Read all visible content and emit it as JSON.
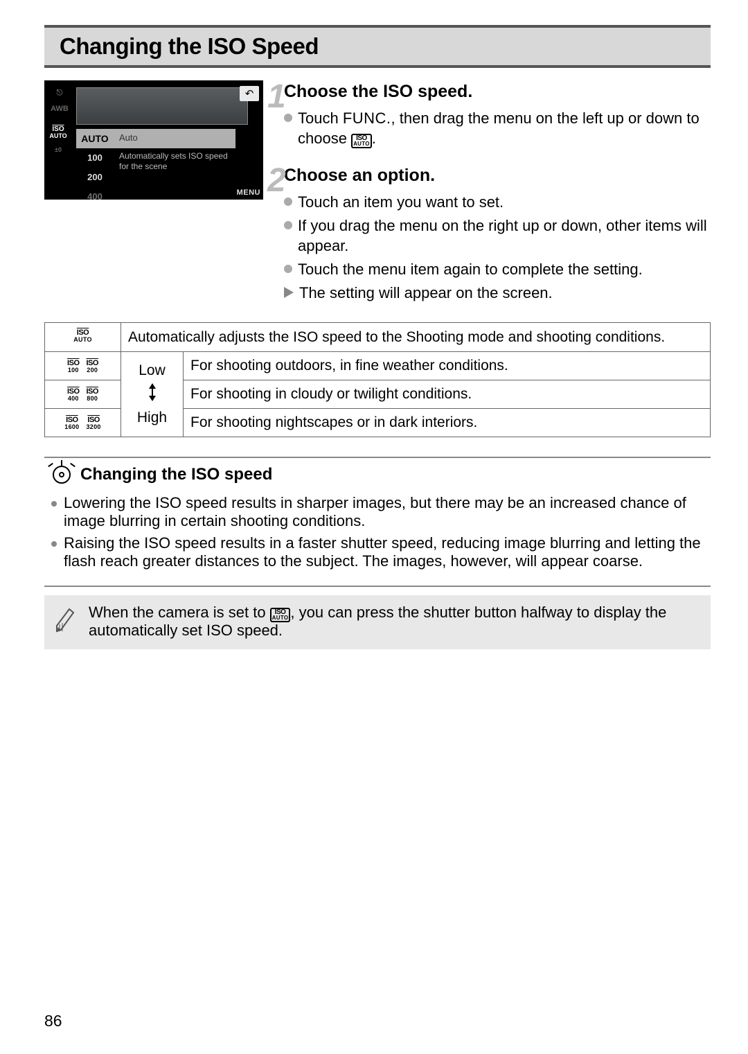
{
  "page_title": "Changing the ISO Speed",
  "screenshot": {
    "back_icon": "↶",
    "left_menu_label": "AUTO",
    "left_menu_values": [
      "100",
      "200",
      "400"
    ],
    "selected_label": "AUTO",
    "desc_header": "Auto",
    "desc_text": "Automatically sets ISO speed for the scene",
    "menu_label": "MENU",
    "side_iso_top": "ISO",
    "side_iso_bottom": "AUTO",
    "side_small_ev": "±0"
  },
  "steps": {
    "s1": {
      "num": "1",
      "title": "Choose the ISO speed.",
      "bullet_pre": "Touch ",
      "func": "FUNC.",
      "bullet_mid": ", then drag the menu on the left up or down to choose ",
      "iso_top": "ISO",
      "iso_bottom": "AUTO",
      "bullet_end": "."
    },
    "s2": {
      "num": "2",
      "title": "Choose an option.",
      "b1": "Touch an item you want to set.",
      "b2": "If you drag the menu on the right up or down, other items will appear.",
      "b3": "Touch the menu item again to complete the setting.",
      "result": "The setting will appear on the screen."
    }
  },
  "table": {
    "r0": {
      "icon_top": "ISO",
      "icon_bottom": "AUTO",
      "desc": "Automatically adjusts the ISO speed to the Shooting mode and shooting conditions."
    },
    "r1": {
      "icons": [
        [
          "ISO",
          "100"
        ],
        [
          "ISO",
          "200"
        ]
      ],
      "level": "Low",
      "desc": "For shooting outdoors, in fine weather conditions."
    },
    "r2": {
      "icons": [
        [
          "ISO",
          "400"
        ],
        [
          "ISO",
          "800"
        ]
      ],
      "desc": "For shooting in cloudy or twilight conditions."
    },
    "r3": {
      "icons": [
        [
          "ISO",
          "1600"
        ],
        [
          "ISO",
          "3200"
        ]
      ],
      "level": "High",
      "desc": "For shooting nightscapes or in dark interiors."
    }
  },
  "tips": {
    "heading": "Changing the ISO speed",
    "t1": "Lowering the ISO speed results in sharper images, but there may be an increased chance of image blurring in certain shooting conditions.",
    "t2": "Raising the ISO speed results in a faster shutter speed, reducing image blurring and letting the flash reach greater distances to the subject. The images, however, will appear coarse."
  },
  "note": {
    "pre": "When the camera is set to ",
    "iso_top": "ISO",
    "iso_bottom": "AUTO",
    "post": ", you can press the shutter button halfway to display the automatically set ISO speed."
  },
  "page_number": "86"
}
